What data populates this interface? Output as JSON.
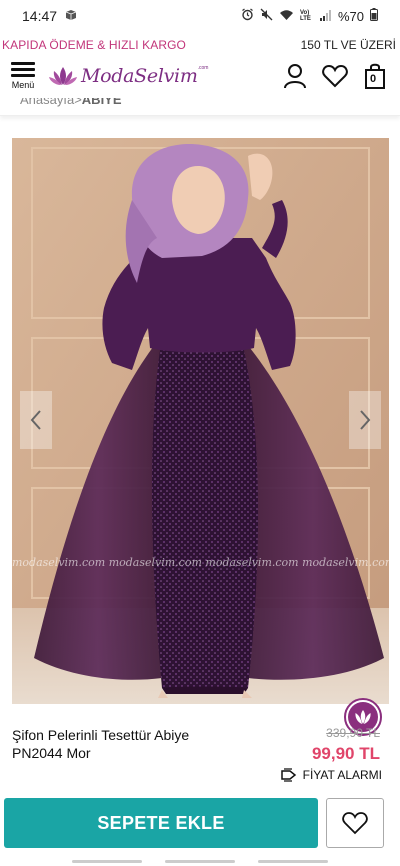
{
  "status_bar": {
    "time": "14:47",
    "battery": "%70",
    "network": "Vo) LTE"
  },
  "promo": {
    "left_text": "KAPIDA ÖDEME & HIZLI KARGO",
    "right_text": "150 TL VE ÜZERİ"
  },
  "header": {
    "menu_label": "Menü",
    "logo_text": "ModaSelvim",
    "logo_tld": ".com",
    "cart_count": "0"
  },
  "breadcrumb": {
    "home": "Anasayfa",
    "separator": ">",
    "current": "ABİYE"
  },
  "product": {
    "watermark": "modaselvim.com   modaselvim.com   modaselvim.com   modaselvim.com",
    "title": "Şifon Pelerinli Tesettür Abiye PN2044 Mor",
    "old_price": "339,90 TL",
    "new_price": "99,90 TL",
    "price_alarm_label": "FİYAT ALARMI"
  },
  "actions": {
    "add_to_cart_label": "SEPETE EKLE"
  },
  "colors": {
    "brand": "#7d2e83",
    "promo": "#c2357a",
    "price": "#e0456a",
    "cta": "#1aa5a5"
  }
}
